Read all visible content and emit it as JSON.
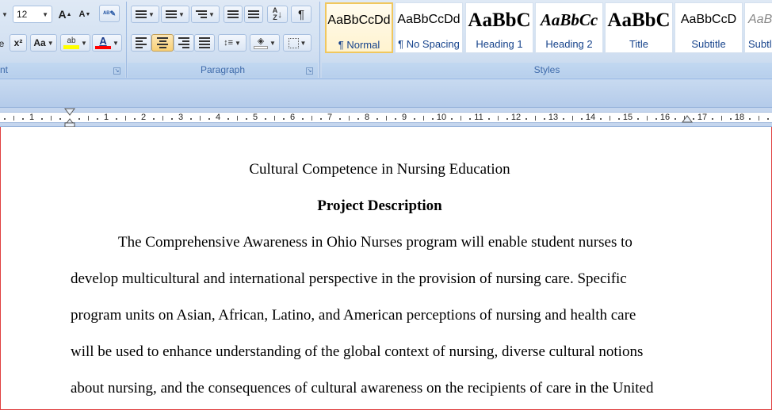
{
  "ribbon": {
    "font": {
      "size_value": "12",
      "grow_icon": "A▲",
      "shrink_icon": "A▼",
      "change_case_label": "Aa",
      "superscript_label": "x²",
      "label_partial": "nt"
    },
    "paragraph": {
      "label": "Paragraph",
      "show_marks_glyph": "¶"
    },
    "styles": {
      "label": "Styles",
      "items": [
        {
          "sample": "AaBbCcDd",
          "name": "¶ Normal"
        },
        {
          "sample": "AaBbCcDd",
          "name": "¶ No Spacing"
        },
        {
          "sample": "AaBbC",
          "name": "Heading 1"
        },
        {
          "sample": "AaBbCc",
          "name": "Heading 2"
        },
        {
          "sample": "AaBbC",
          "name": "Title"
        },
        {
          "sample": "AaBbCcD",
          "name": "Subtitle"
        },
        {
          "sample": "AaBb",
          "name": "Subtl"
        }
      ]
    },
    "colors": {
      "highlight": "#ffff00",
      "font_color": "#ff0000",
      "selected_tile": "#f0c75e"
    }
  },
  "ruler": {
    "numbers": [
      "1",
      "1",
      "2",
      "3",
      "4",
      "5",
      "6",
      "7",
      "8",
      "9",
      "10",
      "11",
      "12",
      "13",
      "14",
      "15",
      "16",
      "17",
      "18"
    ]
  },
  "document": {
    "title": "Cultural Competence in Nursing Education",
    "heading": "Project Description",
    "lines": [
      "The Comprehensive Awareness in Ohio Nurses program will enable student nurses to",
      "develop multicultural and international perspective in the provision of nursing care. Specific",
      "program units on Asian, African, Latino, and American perceptions of nursing and health care",
      "will be used to enhance understanding of the global context of nursing, diverse cultural notions",
      "about nursing, and the consequences of cultural awareness on the recipients of care in the United"
    ]
  }
}
